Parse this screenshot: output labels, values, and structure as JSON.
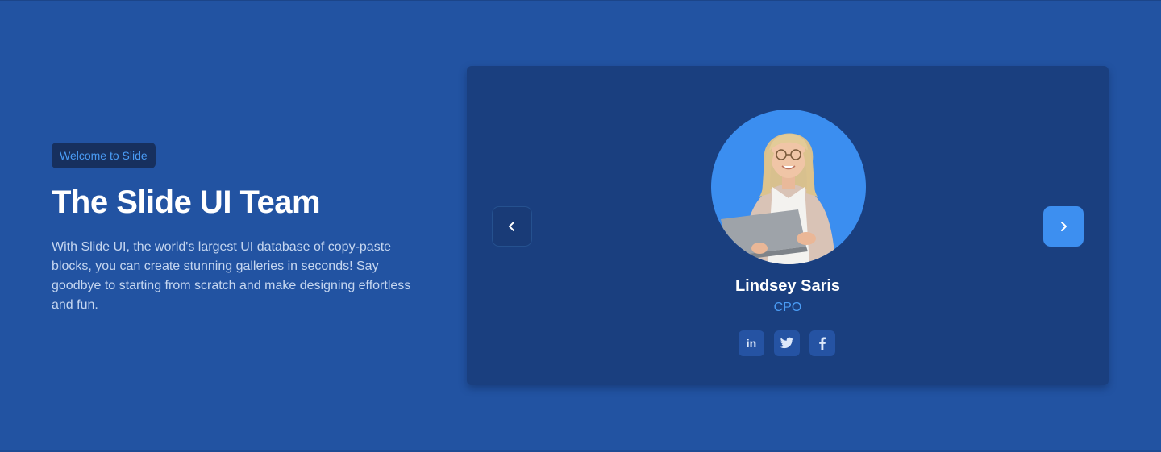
{
  "hero": {
    "badge": "Welcome to Slide",
    "title": "The Slide UI Team",
    "description": "With Slide UI, the world's largest UI database of copy-paste blocks, you can create stunning galleries in seconds! Say goodbye to starting from scratch and make designing effortless and fun."
  },
  "carousel": {
    "prev_icon": "chevron-left-icon",
    "next_icon": "chevron-right-icon",
    "member": {
      "name": "Lindsey Saris",
      "role": "CPO",
      "socials": [
        {
          "icon": "linkedin-icon",
          "glyph": "in"
        },
        {
          "icon": "twitter-icon"
        },
        {
          "icon": "facebook-icon"
        }
      ]
    }
  },
  "colors": {
    "background": "#2253a2",
    "card": "#1a3f7f",
    "accent": "#3d8ff0",
    "badge_bg": "#17305e",
    "badge_text": "#4a9cf5"
  }
}
